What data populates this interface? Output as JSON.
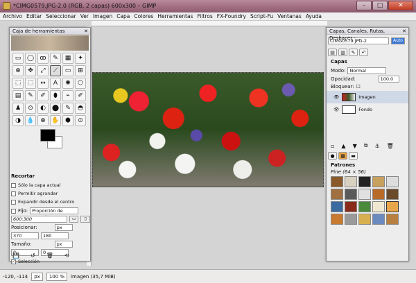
{
  "window": {
    "title": "*CIMG0579.JPG-2.0 (RGB, 2 capas) 600x300 – GIMP",
    "controls": [
      "–",
      "□",
      "✕"
    ]
  },
  "menu": [
    "Archivo",
    "Editar",
    "Seleccionar",
    "Ver",
    "Imagen",
    "Capa",
    "Colores",
    "Herramientas",
    "Filtros",
    "FX-Foundry",
    "Script-Fu",
    "Ventanas",
    "Ayuda"
  ],
  "toolbox": {
    "title": "Caja de herramientas",
    "tools": [
      "▭",
      "◯",
      "ꝏ",
      "✎",
      "▦",
      "✦",
      "⊕",
      "✥",
      "⤢",
      "⟋",
      "▭",
      "⊞",
      "⬚",
      "⬚",
      "↔",
      "A",
      "✺",
      "⬡",
      "▤",
      "✎",
      "✐",
      "⬮",
      "⌁",
      "✐",
      "♟",
      "⊙",
      "◐",
      "⬤",
      "✎",
      "◓",
      "◑",
      "💧",
      "⊕",
      "✋",
      "⬢",
      "⊙"
    ],
    "options": {
      "title": "Recortar",
      "only_layer": "Sólo la capa actual",
      "allow_grow": "Permitir agrandar",
      "expand_center": "Expandir desde el centro",
      "fixed": "Fijo:",
      "fixed_value": "Proporción de aspecto",
      "ratio": "600:300",
      "position_label": "Posicionar:",
      "unit": "px",
      "pos_x": "370",
      "pos_y": "180",
      "size_label": "Tamaño:",
      "size_unit": "px",
      "w": "0",
      "h": "0",
      "selection": "Selección"
    }
  },
  "dock": {
    "title": "Capas, Canales, Rutas, Deshacer - ...",
    "image_name": "CIMG0579.JPG-2",
    "auto": "Auto",
    "capas": "Capas",
    "mode_label": "Modo:",
    "mode": "Normal",
    "opacity_label": "Opacidad:",
    "opacity": "100.0",
    "lock_label": "Bloquear:",
    "layers": [
      "Imagen",
      "Fondo"
    ],
    "patterns_title": "Patrones",
    "patterns_sub": "Pine (64 × 56)"
  },
  "status": {
    "coords": "-120, -114",
    "unit": "px",
    "zoom": "100 %",
    "info": "imagen (35,7 MiB)"
  },
  "colors": {
    "accent": "#a06c80"
  }
}
